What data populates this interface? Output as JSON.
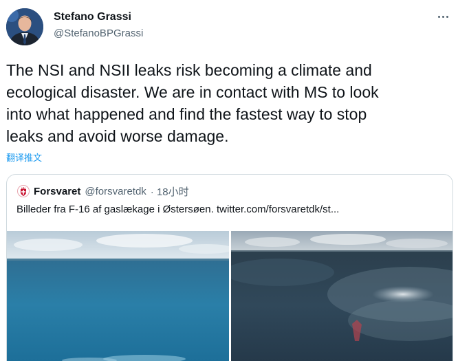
{
  "author": {
    "name": "Stefano Grassi",
    "handle": "@StefanoBPGrassi"
  },
  "tweet": {
    "text": "The NSI and NSII leaks risk becoming a climate and\necological disaster. We are in contact with MS to look\ninto what happened and find the fastest way to stop\nleaks and avoid worse damage.",
    "translate_label": "翻译推文"
  },
  "quoted": {
    "name": "Forsvaret",
    "handle": "@forsvaretdk",
    "time": "· 18小时",
    "text": "Billeder fra F-16 af gaslækage i Østersøen.  twitter.com/forsvaretdk/st..."
  },
  "icons": {
    "more": "more-horizontal-icon",
    "quote_logo": "forsvaret-crest-icon"
  },
  "colors": {
    "text": "#0f1419",
    "secondary": "#536471",
    "link": "#1d9bf0",
    "border": "#cfd9de",
    "forsvaret_red": "#c8102e"
  }
}
